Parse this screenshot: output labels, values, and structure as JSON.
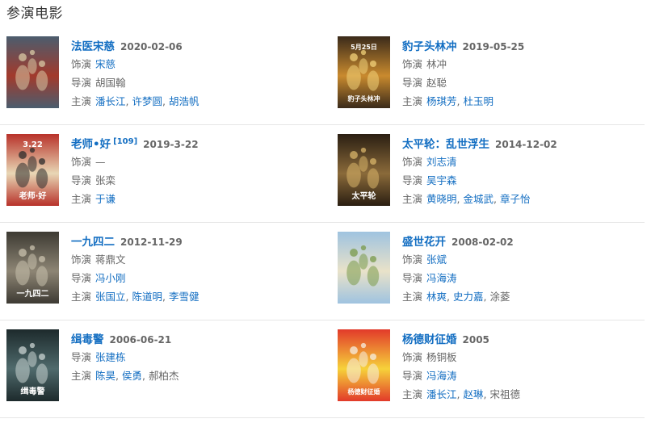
{
  "section_title": "参演电影",
  "labels": {
    "role": "饰演",
    "director": "导演",
    "cast": "主演"
  },
  "separator": ", ",
  "films": [
    {
      "title": "法医宋慈",
      "ref": "",
      "date": "2020-02-06",
      "rows": [
        {
          "label": "饰演",
          "people": [
            {
              "name": "宋慈",
              "link": true
            }
          ]
        },
        {
          "label": "导演",
          "people": [
            {
              "name": "胡国翰",
              "link": false
            }
          ]
        },
        {
          "label": "主演",
          "people": [
            {
              "name": "潘长江",
              "link": true
            },
            {
              "name": "许梦圆",
              "link": true
            },
            {
              "name": "胡浩帆",
              "link": true
            }
          ]
        }
      ],
      "poster_colors": [
        "#4b5d6e",
        "#a23a2c",
        "#d8c9a6"
      ]
    },
    {
      "title": "豹子头林冲",
      "ref": "",
      "date": "2019-05-25",
      "rows": [
        {
          "label": "饰演",
          "people": [
            {
              "name": "林冲",
              "link": false
            }
          ]
        },
        {
          "label": "导演",
          "people": [
            {
              "name": "赵聪",
              "link": false
            }
          ]
        },
        {
          "label": "主演",
          "people": [
            {
              "name": "杨琪芳",
              "link": true
            },
            {
              "name": "杜玉明",
              "link": true
            }
          ]
        }
      ],
      "poster_colors": [
        "#3a2a1a",
        "#c98a2e",
        "#f1d27a"
      ],
      "poster_text": [
        "5月25日",
        "豹子头林冲"
      ]
    },
    {
      "title": "老师•好",
      "ref": "[109]",
      "date": "2019-3-22",
      "rows": [
        {
          "label": "饰演",
          "people": [
            {
              "name": "—",
              "link": false
            }
          ]
        },
        {
          "label": "导演",
          "people": [
            {
              "name": "张栾",
              "link": false
            }
          ]
        },
        {
          "label": "主演",
          "people": [
            {
              "name": "于谦",
              "link": true
            }
          ]
        }
      ],
      "poster_colors": [
        "#b8322a",
        "#e8d7b5",
        "#2b2b2b"
      ],
      "poster_text": [
        "3.22",
        "老师·好"
      ]
    },
    {
      "title": "太平轮：乱世浮生",
      "ref": "",
      "date": "2014-12-02",
      "rows": [
        {
          "label": "饰演",
          "people": [
            {
              "name": "刘志清",
              "link": true
            }
          ]
        },
        {
          "label": "导演",
          "people": [
            {
              "name": "吴宇森",
              "link": true
            }
          ]
        },
        {
          "label": "主演",
          "people": [
            {
              "name": "黄晓明",
              "link": true
            },
            {
              "name": "金城武",
              "link": true
            },
            {
              "name": "章子怡",
              "link": true
            }
          ]
        }
      ],
      "poster_colors": [
        "#2a1e12",
        "#8a6a3a",
        "#d8b46a"
      ],
      "poster_text": [
        "太平轮"
      ]
    },
    {
      "title": "一九四二",
      "ref": "",
      "date": "2012-11-29",
      "rows": [
        {
          "label": "饰演",
          "people": [
            {
              "name": "蒋鼎文",
              "link": false
            }
          ]
        },
        {
          "label": "导演",
          "people": [
            {
              "name": "冯小刚",
              "link": true
            }
          ]
        },
        {
          "label": "主演",
          "people": [
            {
              "name": "张国立",
              "link": true
            },
            {
              "name": "陈道明",
              "link": true
            },
            {
              "name": "李雪健",
              "link": true
            }
          ]
        }
      ],
      "poster_colors": [
        "#3d3a33",
        "#8d8574",
        "#c9c1ad"
      ],
      "poster_text": [
        "一九四二"
      ]
    },
    {
      "title": "盛世花开",
      "ref": "",
      "date": "2008-02-02",
      "rows": [
        {
          "label": "饰演",
          "people": [
            {
              "name": "张斌",
              "link": true
            }
          ]
        },
        {
          "label": "导演",
          "people": [
            {
              "name": "冯海涛",
              "link": true
            }
          ]
        },
        {
          "label": "主演",
          "people": [
            {
              "name": "林爽",
              "link": true
            },
            {
              "name": "史力嘉",
              "link": true
            },
            {
              "name": "涂菱",
              "link": false
            }
          ]
        }
      ],
      "poster_colors": [
        "#9fc3e0",
        "#e9e2c9",
        "#7a9a4a"
      ]
    },
    {
      "title": "缉毒警",
      "ref": "",
      "date": "2006-06-21",
      "rows": [
        {
          "label": "导演",
          "people": [
            {
              "name": "张建栋",
              "link": true
            }
          ]
        },
        {
          "label": "主演",
          "people": [
            {
              "name": "陈昊",
              "link": true
            },
            {
              "name": "侯勇",
              "link": true
            },
            {
              "name": "郝柏杰",
              "link": false
            }
          ]
        }
      ],
      "poster_colors": [
        "#1d2a2c",
        "#4f6a6c",
        "#c9d3d2"
      ],
      "poster_text": [
        "缉毒警"
      ]
    },
    {
      "title": "杨德财征婚",
      "ref": "",
      "date": "2005",
      "rows": [
        {
          "label": "饰演",
          "people": [
            {
              "name": "杨铜板",
              "link": false
            }
          ]
        },
        {
          "label": "导演",
          "people": [
            {
              "name": "冯海涛",
              "link": true
            }
          ]
        },
        {
          "label": "主演",
          "people": [
            {
              "name": "潘长江",
              "link": true
            },
            {
              "name": "赵琳",
              "link": true
            },
            {
              "name": "宋祖德",
              "link": false
            }
          ]
        }
      ],
      "poster_colors": [
        "#e23a2a",
        "#f6d23a",
        "#f6efe2"
      ],
      "poster_text": [
        "杨德财征婚"
      ]
    }
  ]
}
